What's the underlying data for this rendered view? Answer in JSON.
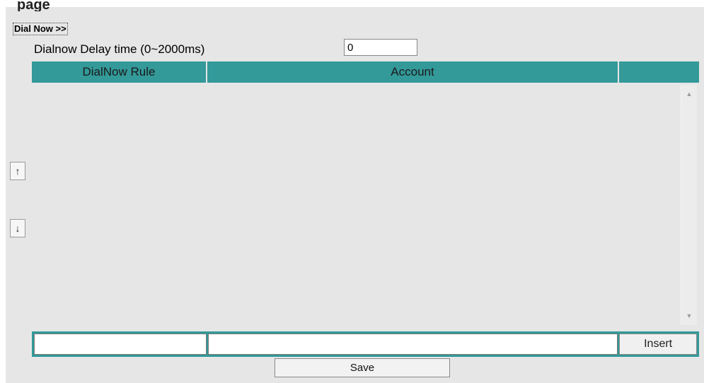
{
  "page": {
    "cut_title": "page"
  },
  "section": {
    "link_label": "Dial Now >>"
  },
  "delay": {
    "label": "Dialnow Delay time (0~2000ms)",
    "value": "0"
  },
  "table": {
    "headers": [
      "DialNow Rule",
      "Account",
      ""
    ],
    "rows": []
  },
  "reorder": {
    "up_label": "↑",
    "down_label": "↓"
  },
  "scrollbar": {
    "up_glyph": "▲",
    "down_glyph": "▼"
  },
  "entry": {
    "rule_value": "",
    "account_value": "",
    "insert_label": "Insert"
  },
  "actions": {
    "save_label": "Save"
  },
  "colors": {
    "header_bg": "#339999",
    "panel_bg": "#e6e6e6"
  }
}
